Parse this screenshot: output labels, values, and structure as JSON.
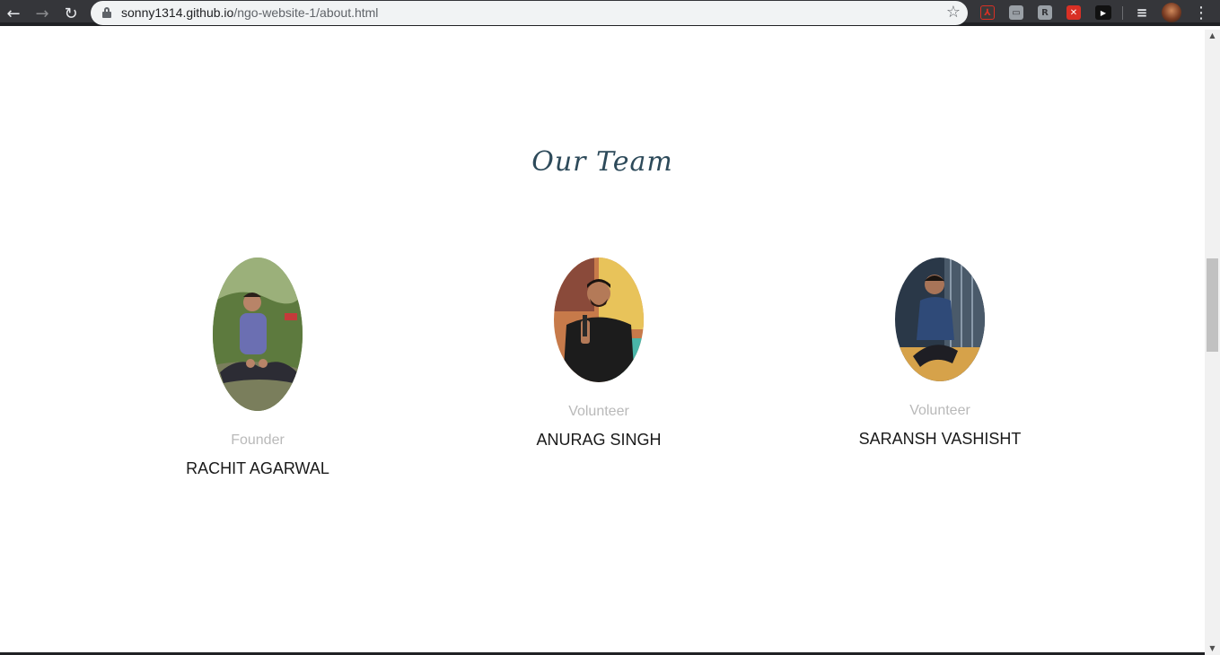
{
  "browser": {
    "url_host": "sonny1314.github.io",
    "url_path": "/ngo-website-1/about.html",
    "back_icon": "←",
    "forward_icon": "→",
    "reload_icon": "↻",
    "star_icon": "☆",
    "menu_icon": "⋮",
    "extensions": [
      {
        "name": "pdf-extension-icon",
        "color": "#3a3a3a",
        "glyph": "⅄"
      },
      {
        "name": "screen-extension-icon",
        "color": "#9aa0a6",
        "glyph": "▭"
      },
      {
        "name": "r-extension-icon",
        "color": "#9aa0a6",
        "glyph": "R"
      },
      {
        "name": "blocker-extension-icon",
        "color": "#d93025",
        "glyph": "✕"
      },
      {
        "name": "youtube-extension-icon",
        "color": "#111111",
        "glyph": "▶"
      },
      {
        "name": "playlist-extension-icon",
        "color": "#35363a",
        "glyph": "≡"
      }
    ]
  },
  "page": {
    "section_title": "Our Team",
    "members": [
      {
        "role": "Founder",
        "name": "RACHIT AGARWAL"
      },
      {
        "role": "Volunteer",
        "name": "ANURAG SINGH"
      },
      {
        "role": "Volunteer",
        "name": "SARANSH VASHISHT"
      }
    ]
  }
}
